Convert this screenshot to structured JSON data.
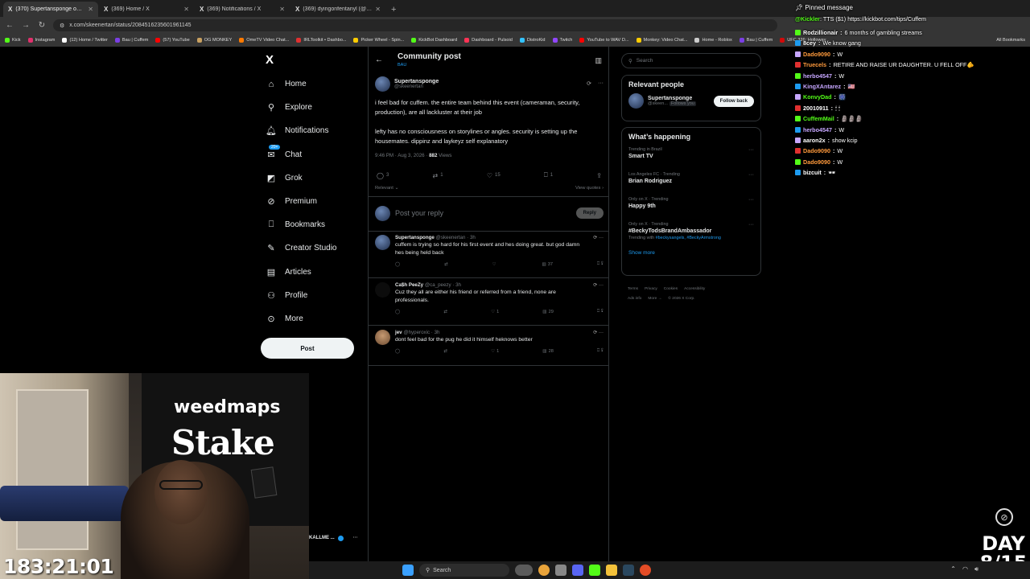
{
  "browser": {
    "tabs": [
      {
        "title": "(370) Supertansponge on X: \"i fe",
        "active": true
      },
      {
        "title": "(369) Home / X",
        "active": false
      },
      {
        "title": "(369) Notifications / X",
        "active": false
      },
      {
        "title": "(369) dyingonfentanyl (@fent",
        "active": false
      }
    ],
    "url": "x.com/skeenertan/status/2084516235601961145",
    "bookmarks": [
      {
        "label": "Kick",
        "color": "#53fc18"
      },
      {
        "label": "Instagram",
        "color": "#e1306c"
      },
      {
        "label": "(12) Home / Twitter",
        "color": "#ffffff"
      },
      {
        "label": "Bau | Cuffem",
        "color": "#7b3fe4"
      },
      {
        "label": "(57) YouTube",
        "color": "#ff0000"
      },
      {
        "label": "OG MONKEY",
        "color": "#c8a060"
      },
      {
        "label": "OmeTV Video Chat...",
        "color": "#ff7a00"
      },
      {
        "label": "IRLToolkit • Dashbo...",
        "color": "#e03030"
      },
      {
        "label": "Picker Wheel - Spin...",
        "color": "#ffcc00"
      },
      {
        "label": "KickBot Dashboard",
        "color": "#53fc18"
      },
      {
        "label": "Dashboard - Pulsoid",
        "color": "#ff3355"
      },
      {
        "label": "DistroKid",
        "color": "#33c3ff"
      },
      {
        "label": "Twitch",
        "color": "#9146ff"
      },
      {
        "label": "YouTube to WAV D...",
        "color": "#ff0000"
      },
      {
        "label": "Monkey: Video Chat...",
        "color": "#ffcc00"
      },
      {
        "label": "Home - Roblox",
        "color": "#cccccc"
      },
      {
        "label": "Bau | Cuffem",
        "color": "#7b3fe4"
      },
      {
        "label": "UFC 326: Holloway...",
        "color": "#d20a0a"
      }
    ],
    "all_bookmarks": "All Bookmarks"
  },
  "x_nav": {
    "logo": "X",
    "items": [
      {
        "label": "Home",
        "icon": "home-icon",
        "glyph": "⌂"
      },
      {
        "label": "Explore",
        "icon": "search-icon",
        "glyph": "⚲"
      },
      {
        "label": "Notifications",
        "icon": "bell-icon",
        "glyph": "🔔︎"
      },
      {
        "label": "Chat",
        "icon": "chat-icon",
        "glyph": "✉"
      },
      {
        "label": "Grok",
        "icon": "grok-icon",
        "glyph": "◩"
      },
      {
        "label": "Premium",
        "icon": "premium-icon",
        "glyph": "⊘"
      },
      {
        "label": "Bookmarks",
        "icon": "bookmark-icon",
        "glyph": "⎕"
      },
      {
        "label": "Creator Studio",
        "icon": "creator-studio-icon",
        "glyph": "✎"
      },
      {
        "label": "Articles",
        "icon": "articles-icon",
        "glyph": "▤"
      },
      {
        "label": "Profile",
        "icon": "profile-icon",
        "glyph": "⚇"
      },
      {
        "label": "More",
        "icon": "more-icon",
        "glyph": "⊙"
      }
    ],
    "chat_badge": "20+",
    "post_button": "Post",
    "account_name": "KALLME ..."
  },
  "main": {
    "header_title": "Community post",
    "header_sub": "BAU",
    "post": {
      "name": "Supertansponge",
      "handle": "@skeenertan",
      "text_1": "i feel bad for cuffem. the entire team behind this event (cameraman, security, production), are all lackluster at their job",
      "text_2": "lefty has no consciousness on storylines or angles. security is setting up the housemates. dippinz and laykeyz self explanatory",
      "time": "9:46 PM · Aug 3, 2026 · ",
      "views_count": "882",
      "views_label": " Views",
      "replies": "3",
      "reposts": "1",
      "likes": "15",
      "bookmarks": "1",
      "relevant": "Relevant",
      "view_quotes": "View quotes"
    },
    "reply_placeholder": "Post your reply",
    "reply_button": "Reply",
    "replies": [
      {
        "name": "Supertansponge",
        "meta": " @skeenertan · 3h",
        "text": "cuffem is trying so hard for his first event and hes doing great. but god damn hes being held back",
        "likes": "",
        "views": "37"
      },
      {
        "name": "Ca$h PeeZy",
        "meta": " @ca_peezy · 3h",
        "text": "Cuz they all are either his friend or referred from a friend, none are professionals.",
        "likes": "1",
        "views": "29"
      },
      {
        "name": "jev",
        "meta": " @hyperoxic · 3h",
        "text": "dont feel bad for the pug he did it himself heknows better",
        "likes": "1",
        "views": "28"
      }
    ]
  },
  "sidebar": {
    "search_placeholder": "Search",
    "relevant_title": "Relevant people",
    "relevant_name": "Supertansponge",
    "relevant_handle": "@skeen...",
    "follows_you": "Follows you",
    "follow_back": "Follow back",
    "happening_title": "What’s happening",
    "trends": [
      {
        "context": "Trending in Brazil",
        "name": "Smart TV",
        "with": ""
      },
      {
        "context": "Los Angeles FC · Trending",
        "name": "Brian Rodriguez",
        "with": ""
      },
      {
        "context": "Only on X · Trending",
        "name": "Happy 9th",
        "with": ""
      },
      {
        "context": "Only on X · Trending",
        "name": "#BeckyTodsBrandAmbassador",
        "with": "#beckysangels, #BeckyArmstrong"
      }
    ],
    "trending_with": "Trending with",
    "show_more": "Show more",
    "footer_1": [
      "Terms",
      "Privacy",
      "Cookies",
      "Accessibility"
    ],
    "footer_2": [
      "Ads info",
      "More →",
      "© 2026 X Corp."
    ]
  },
  "chat": {
    "pinned_label": "Pinned message",
    "pinned_user": "@Kickler",
    "pinned_text": ": TTS ($1) https://kickbot.com/tips/Cuffem",
    "lines": [
      {
        "user": "Rodzillionair",
        "color": "#ffffff",
        "msg": "6 months of gambling streams"
      },
      {
        "user": "8cey",
        "color": "#ffffff",
        "msg": "We know gang"
      },
      {
        "user": "Dado9090",
        "color": "#ff9a3c",
        "msg": "W"
      },
      {
        "user": "Truecels",
        "color": "#ff9a3c",
        "msg": "RETIRE AND RAISE UR DAUGHTER. U FELL OFF🫵"
      },
      {
        "user": "herbo4547",
        "color": "#c6a6ff",
        "msg": "W"
      },
      {
        "user": "KingXAntarez",
        "color": "#c6a6ff",
        "msg": "🇺🇸"
      },
      {
        "user": "KonvyDad",
        "color": "#53fc18",
        "msg": "🎆"
      },
      {
        "user": "20010911",
        "color": "#ffffff",
        "msg": "🕯 🕯"
      },
      {
        "user": "CuffemMail",
        "color": "#53fc18",
        "msg": "🗿🗿🗿"
      },
      {
        "user": "herbo4547",
        "color": "#c6a6ff",
        "msg": "W"
      },
      {
        "user": "aaron2x",
        "color": "#ffffff",
        "msg": "show kcip"
      },
      {
        "user": "Dado9090",
        "color": "#ff9a3c",
        "msg": "W"
      },
      {
        "user": "Dado9090",
        "color": "#ff9a3c",
        "msg": "W"
      },
      {
        "user": "bizcuit",
        "color": "#ffffff",
        "msg": "🕶"
      }
    ]
  },
  "stream": {
    "timer": "183:21:01",
    "day_label": "DAY",
    "day_count": "8/15",
    "cam_brand_1": "weedmaps",
    "cam_brand_2": "Stake"
  },
  "taskbar": {
    "search_label": "Search"
  }
}
